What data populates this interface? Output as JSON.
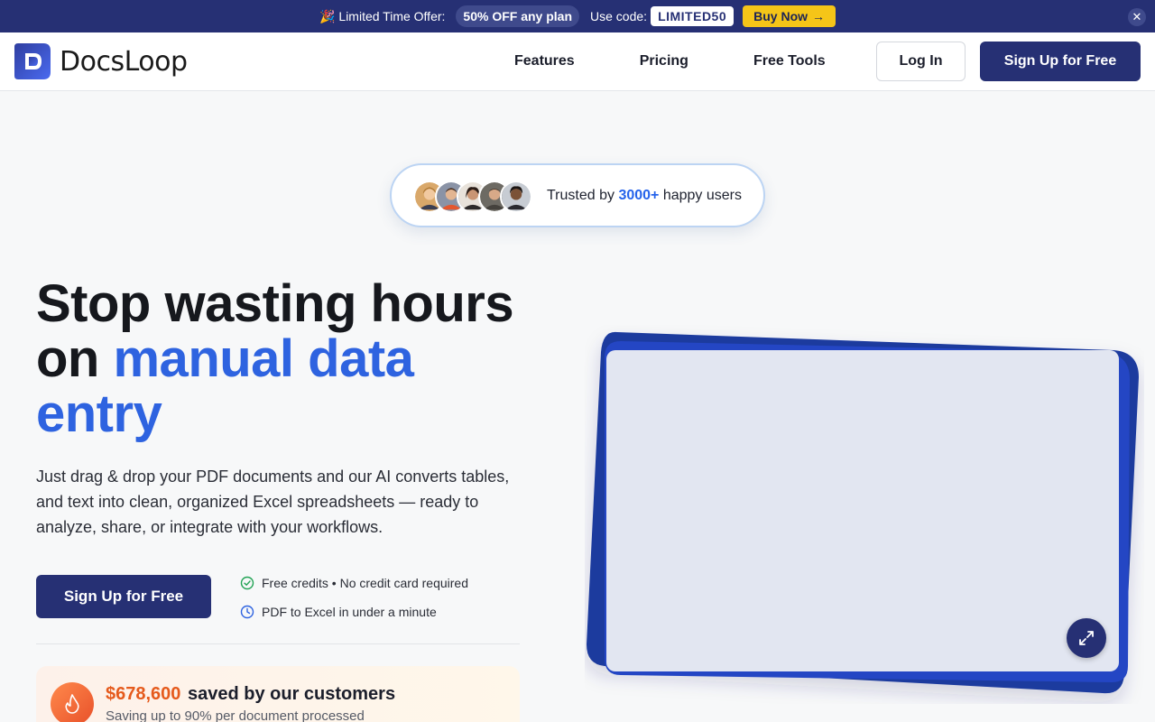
{
  "promo": {
    "emoji": "🎉",
    "text": "Limited Time Offer:",
    "deal": "50% OFF any plan",
    "code_label": "Use code:",
    "code": "LIMITED50",
    "buy_label": "Buy Now",
    "buy_arrow": "→",
    "close_symbol": "✕"
  },
  "header": {
    "brand": "DocsLoop",
    "nav": [
      "Features",
      "Pricing",
      "Free Tools"
    ],
    "login_label": "Log In",
    "signup_label": "Sign Up for Free"
  },
  "trust": {
    "prefix": "Trusted by ",
    "count": "3000+",
    "suffix": " happy users",
    "avatar_count": 5
  },
  "hero": {
    "title_line1": "Stop wasting hours",
    "title_on": "on ",
    "title_accent_1": "manual data",
    "title_accent_2": "entry",
    "description": "Just drag & drop your PDF documents and our AI converts tables, and text into clean, organized Excel spreadsheets — ready to analyze, share, or integrate with your workflows.",
    "cta_label": "Sign Up for Free",
    "perks": [
      "Free credits • No credit card required",
      "PDF to Excel in under a minute"
    ]
  },
  "savings": {
    "amount": "$678,600",
    "label": "saved by our customers",
    "sub": "Saving up to 90% per document processed"
  },
  "colors": {
    "brand_navy": "#263074",
    "accent_blue": "#2e63e0",
    "highlight_yellow": "#f5c518",
    "savings_orange": "#e55a1c"
  },
  "icons": {
    "perk1": "check-circle-icon",
    "perk2": "clock-icon",
    "savings": "flame-icon",
    "preview": "expand-icon"
  }
}
